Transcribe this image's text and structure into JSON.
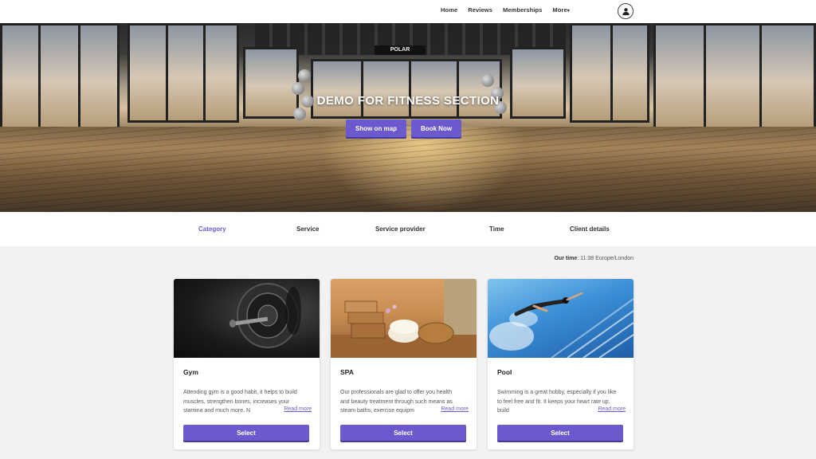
{
  "nav": {
    "items": [
      "Home",
      "Reviews",
      "Memberships"
    ],
    "more_label": "More",
    "more_caret": "▾"
  },
  "user": {
    "icon": "user-icon"
  },
  "hero": {
    "sign_text": "POLAR",
    "title": "DEMO FOR FITNESS SECTION",
    "map_button": "Show on map",
    "book_button": "Book Now"
  },
  "steps": [
    "Category",
    "Service",
    "Service provider",
    "Time",
    "Client details"
  ],
  "active_step": "Category",
  "time": {
    "label": "Our time",
    "value": ": 11:38 Europe/London"
  },
  "cards": [
    {
      "title": "Gym",
      "description": "Attending gym is a good habit, it helps to build muscles, strengthen bones, increases your stamina and much more. N",
      "read_more": "Read more",
      "select": "Select"
    },
    {
      "title": "SPA",
      "description": "Our professionals are glad to offer you health and beauty treatment through such means as steam baths, exercise equipm",
      "read_more": "Read more",
      "select": "Select"
    },
    {
      "title": "Pool",
      "description": "Swimming is a great hobby, especially if you like to feel free and fit. It keeps your heart rate up, build",
      "read_more": "Read more",
      "select": "Select"
    }
  ],
  "colors": {
    "accent": "#6a5acd",
    "background": "#f2f2f2"
  }
}
